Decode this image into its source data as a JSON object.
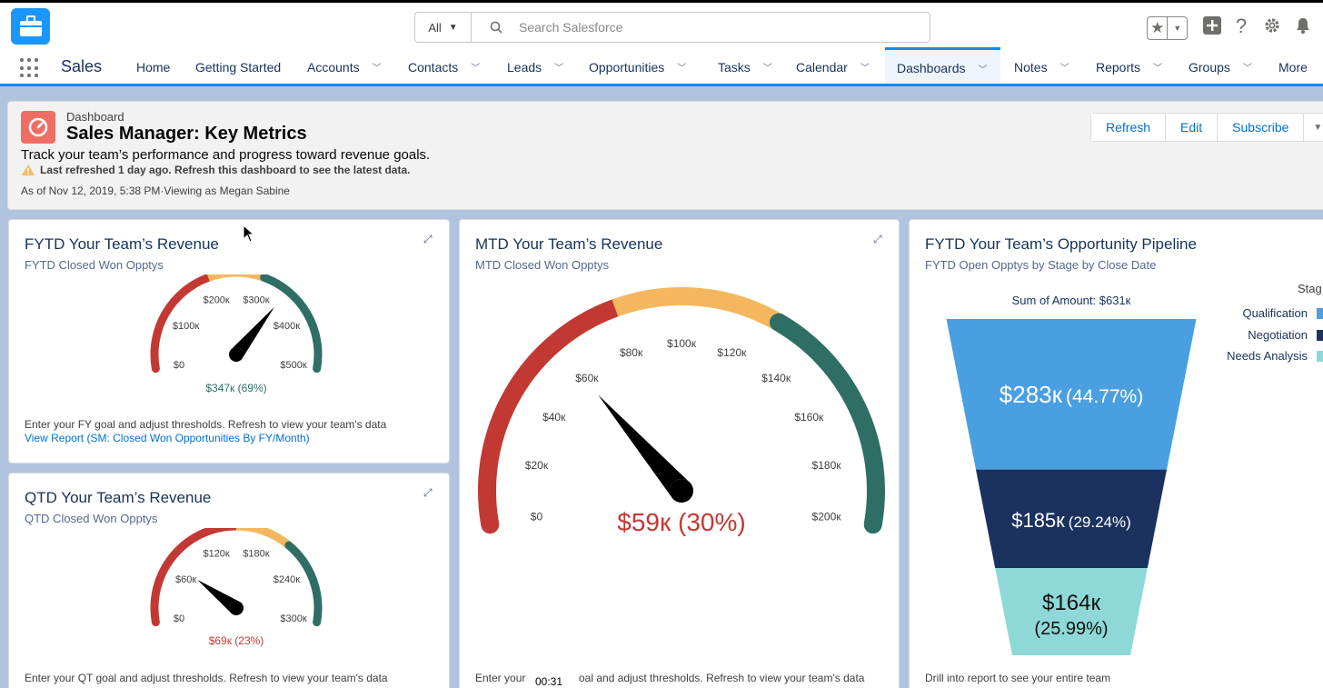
{
  "header": {
    "search_scope": "All",
    "search_placeholder": "Search Salesforce"
  },
  "nav": {
    "app_name": "Sales",
    "items": [
      {
        "label": "Home",
        "has_menu": false
      },
      {
        "label": "Getting Started",
        "has_menu": false
      },
      {
        "label": "Accounts",
        "has_menu": true
      },
      {
        "label": "Contacts",
        "has_menu": true
      },
      {
        "label": "Leads",
        "has_menu": true
      },
      {
        "label": "Opportunities",
        "has_menu": true
      },
      {
        "label": "Tasks",
        "has_menu": true
      },
      {
        "label": "Calendar",
        "has_menu": true
      },
      {
        "label": "Dashboards",
        "has_menu": true,
        "active": true
      },
      {
        "label": "Notes",
        "has_menu": true
      },
      {
        "label": "Reports",
        "has_menu": true
      },
      {
        "label": "Groups",
        "has_menu": true
      },
      {
        "label": "More",
        "has_menu": false
      }
    ]
  },
  "dashboard": {
    "type_label": "Dashboard",
    "title": "Sales Manager: Key Metrics",
    "description": "Track your team’s performance and progress toward revenue goals.",
    "warning": "Last refreshed 1 day ago. Refresh this dashboard to see the latest data.",
    "as_of": "As of Nov 12, 2019, 5:38 PM·Viewing as Megan Sabine",
    "buttons": {
      "refresh": "Refresh",
      "edit": "Edit",
      "subscribe": "Subscribe"
    }
  },
  "cards": {
    "fytd_revenue": {
      "title": "FYTD Your Team’s Revenue",
      "subtitle": "FYTD Closed Won Opptys",
      "footer": "Enter your FY goal and adjust thresholds. Refresh to view your team's data",
      "link": "View Report (SM: Closed Won Opportunities By FY/Month)"
    },
    "qtd_revenue": {
      "title": "QTD Your Team’s Revenue",
      "subtitle": "QTD Closed Won Opptys",
      "footer": "Enter your QT goal and adjust thresholds. Refresh to view your team's data"
    },
    "mtd_revenue": {
      "title": "MTD Your Team’s Revenue",
      "subtitle": "MTD Closed Won Opptys",
      "footer_left": "Enter your",
      "footer_right": "oal and adjust thresholds. Refresh to view your team's data"
    },
    "pipeline": {
      "title": "FYTD Your Team’s Opportunity Pipeline",
      "subtitle": "FYTD Open Opptys by Stage by Close Date",
      "footer": "Drill into report to see your entire team",
      "legend_title": "Stag"
    }
  },
  "overlay": {
    "timer": "00:31"
  },
  "colors": {
    "gauge_red": "#c23934",
    "gauge_yellow": "#f4b75f",
    "gauge_green": "#2e6e64",
    "funnel_1": "#4a9fe0",
    "funnel_2": "#1b325f",
    "funnel_3": "#8ed8d8",
    "brand_blue": "#1589ee"
  },
  "chart_data": [
    {
      "type": "gauge",
      "id": "fytd",
      "ticks": [
        "$0",
        "$100к",
        "$200к",
        "$300к",
        "$400к",
        "$500к"
      ],
      "min": 0,
      "max": 500000,
      "bands": [
        {
          "from": 0,
          "to": 200000,
          "color": "red"
        },
        {
          "from": 200000,
          "to": 300000,
          "color": "yellow"
        },
        {
          "from": 300000,
          "to": 500000,
          "color": "green"
        }
      ],
      "value": 347000,
      "value_label": "$347к (69%)"
    },
    {
      "type": "gauge",
      "id": "qtd",
      "ticks": [
        "$0",
        "$60к",
        "$120к",
        "$180к",
        "$240к",
        "$300к"
      ],
      "min": 0,
      "max": 300000,
      "bands": [
        {
          "from": 0,
          "to": 150000,
          "color": "red"
        },
        {
          "from": 150000,
          "to": 210000,
          "color": "yellow"
        },
        {
          "from": 210000,
          "to": 300000,
          "color": "green"
        }
      ],
      "value": 69000,
      "value_label": "$69к (23%)"
    },
    {
      "type": "gauge",
      "id": "mtd",
      "ticks": [
        "$0",
        "$20к",
        "$40к",
        "$60к",
        "$80к",
        "$100к",
        "$120к",
        "$140к",
        "$160к",
        "$180к",
        "$200к"
      ],
      "min": 0,
      "max": 200000,
      "bands": [
        {
          "from": 0,
          "to": 80000,
          "color": "red"
        },
        {
          "from": 80000,
          "to": 130000,
          "color": "yellow"
        },
        {
          "from": 130000,
          "to": 200000,
          "color": "green"
        }
      ],
      "value": 59000,
      "value_label": "$59к (30%)"
    },
    {
      "type": "funnel",
      "id": "pipeline",
      "title": "Sum of Amount: $631к",
      "series": [
        {
          "name": "Qualification",
          "value": 283,
          "label": "$283к",
          "pct": "(44.77%)"
        },
        {
          "name": "Negotiation",
          "value": 185,
          "label": "$185к",
          "pct": "(29.24%)"
        },
        {
          "name": "Needs Analysis",
          "value": 164,
          "label": "$164к",
          "pct": "(25.99%)"
        }
      ]
    }
  ]
}
